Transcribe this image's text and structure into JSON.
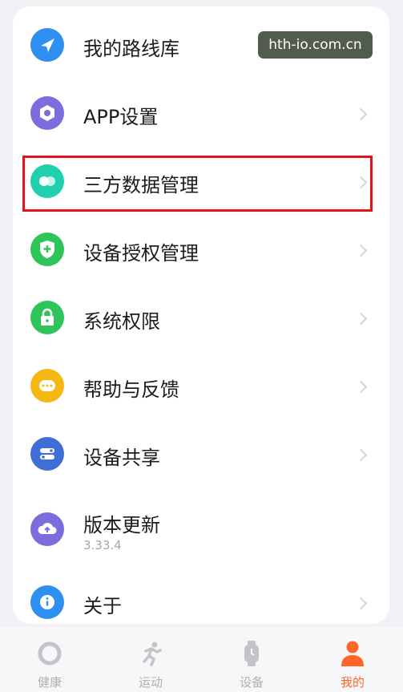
{
  "menu": [
    {
      "key": "routes",
      "label": "我的路线库",
      "icon": "navigation-arrow-icon",
      "color": "#2d8ff0"
    },
    {
      "key": "app_settings",
      "label": "APP设置",
      "icon": "settings-icon",
      "color": "#7b6ddc"
    },
    {
      "key": "third_party",
      "label": "三方数据管理",
      "icon": "toggle-circles-icon",
      "color": "#1fcfae"
    },
    {
      "key": "device_auth",
      "label": "设备授权管理",
      "icon": "shield-plus-icon",
      "color": "#2fc45a"
    },
    {
      "key": "permissions",
      "label": "系统权限",
      "icon": "lock-icon",
      "color": "#2fc45a"
    },
    {
      "key": "feedback",
      "label": "帮助与反馈",
      "icon": "chat-dots-icon",
      "color": "#f4b810"
    },
    {
      "key": "device_share",
      "label": "设备共享",
      "icon": "share-toggle-icon",
      "color": "#3f6fd6"
    },
    {
      "key": "update",
      "label": "版本更新",
      "sublabel": "3.33.4",
      "icon": "cloud-upload-icon",
      "color": "#7b6ddc"
    },
    {
      "key": "about",
      "label": "关于",
      "icon": "info-icon",
      "color": "#2d8ff0"
    }
  ],
  "watermark": "hth-io.com.cn",
  "nav": [
    {
      "label": "健康",
      "icon": "ring-icon"
    },
    {
      "label": "运动",
      "icon": "running-icon"
    },
    {
      "label": "设备",
      "icon": "watch-icon"
    },
    {
      "label": "我的",
      "icon": "person-icon",
      "active": true
    }
  ],
  "colors": {
    "accent": "#ff6526",
    "highlight": "#e0141b",
    "inactive": "#b0b0b4"
  }
}
